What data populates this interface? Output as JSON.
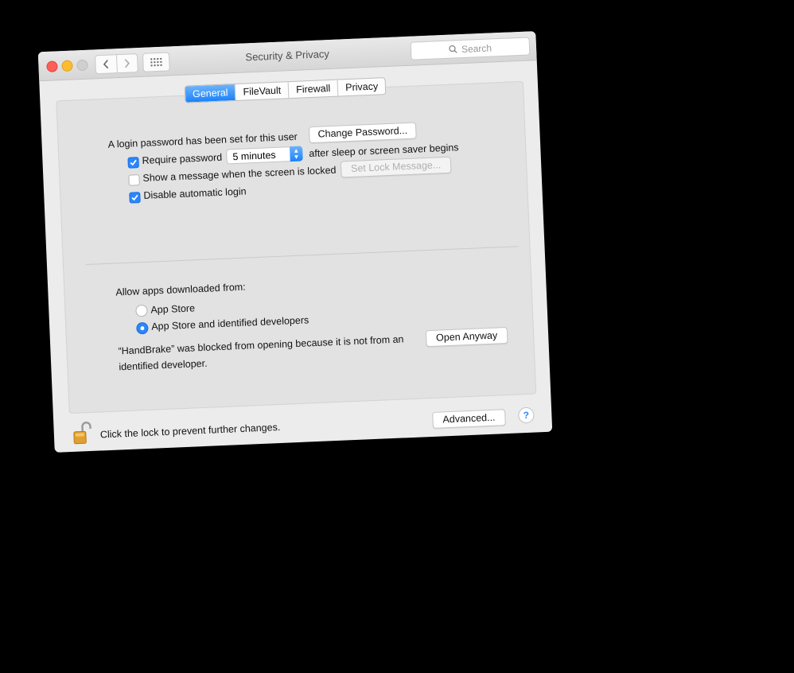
{
  "window": {
    "title": "Security & Privacy",
    "search_placeholder": "Search"
  },
  "tabs": [
    {
      "label": "General",
      "active": true
    },
    {
      "label": "FileVault",
      "active": false
    },
    {
      "label": "Firewall",
      "active": false
    },
    {
      "label": "Privacy",
      "active": false
    }
  ],
  "general": {
    "login_text": "A login password has been set for this user",
    "change_password_button": "Change Password...",
    "require_password": {
      "checked": true,
      "label": "Require password"
    },
    "require_password_delay": "5 minutes",
    "after_sleep_text": "after sleep or screen saver begins",
    "show_message": {
      "checked": false,
      "label": "Show a message when the screen is locked"
    },
    "set_lock_message_button": "Set Lock Message...",
    "disable_auto_login": {
      "checked": true,
      "label": "Disable automatic login"
    }
  },
  "gatekeeper": {
    "heading": "Allow apps downloaded from:",
    "options": [
      {
        "label": "App Store",
        "selected": false
      },
      {
        "label": "App Store and identified developers",
        "selected": true
      }
    ],
    "blocked_line1": "“HandBrake” was blocked from opening because it is not from an",
    "blocked_line2": "identified developer.",
    "open_anyway_button": "Open Anyway"
  },
  "footer": {
    "lock_text": "Click the lock to prevent further changes.",
    "advanced_button": "Advanced...",
    "help_label": "?"
  },
  "colors": {
    "accent": "#1a82fb",
    "close": "#fc5f57",
    "minimize": "#fdbc2e",
    "lock": "#e0a030"
  }
}
